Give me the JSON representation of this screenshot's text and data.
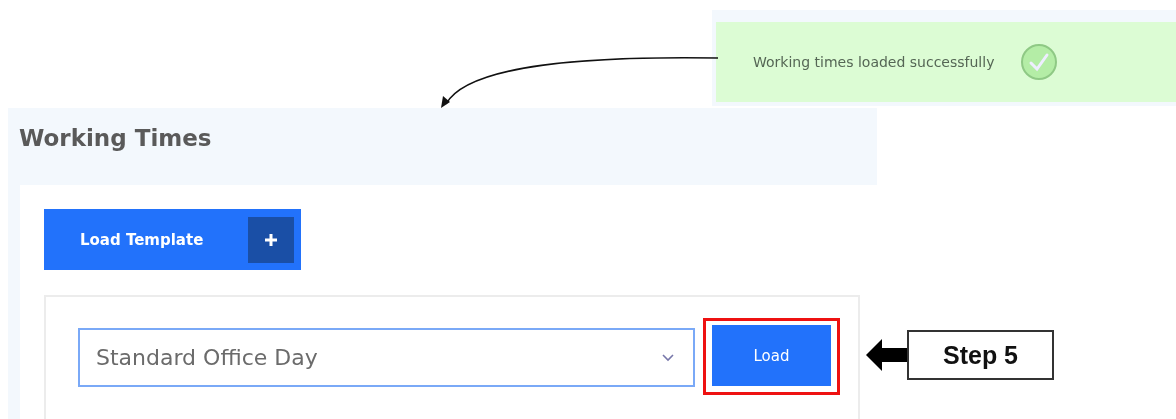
{
  "toast": {
    "message": "Working times loaded successfully"
  },
  "panel": {
    "title": "Working Times",
    "template_button": {
      "label": "Load Template"
    },
    "template_select": {
      "value": "Standard Office Day"
    },
    "load_button": {
      "label": "Load",
      "highlighted": true
    }
  },
  "callout": {
    "label": "Step 5"
  }
}
